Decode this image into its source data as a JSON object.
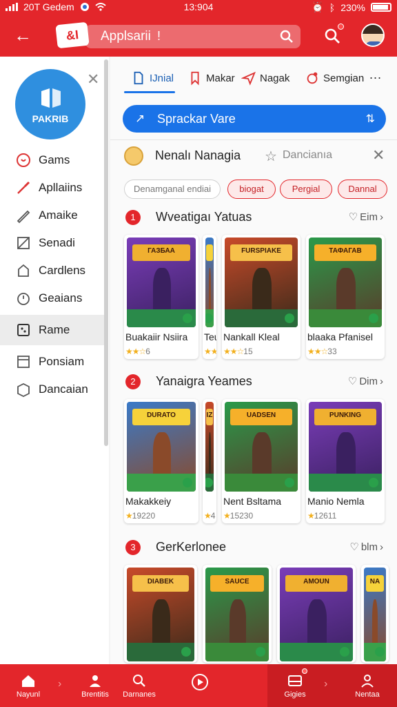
{
  "status": {
    "carrier": "20T Gedem",
    "time": "13:904",
    "battery": "230%"
  },
  "appbar": {
    "logo_text": "&I",
    "search_text": "Applsarii",
    "search_mark": "!"
  },
  "sidebar": {
    "brand_label": "PAKRIB",
    "items": [
      {
        "label": "Gams",
        "icon": "chat-icon"
      },
      {
        "label": "Apllaiins",
        "icon": "brush-icon"
      },
      {
        "label": "Amaike",
        "icon": "pencil-icon"
      },
      {
        "label": "Senadi",
        "icon": "slash-icon"
      },
      {
        "label": "Cardlens",
        "icon": "bag-icon"
      },
      {
        "label": "Geaians",
        "icon": "clock-icon"
      },
      {
        "label": "Rame",
        "icon": "dice-icon",
        "active": true
      },
      {
        "label": "Ponsiam",
        "icon": "window-icon"
      },
      {
        "label": "Dancaian",
        "icon": "box-icon"
      }
    ]
  },
  "tabs": [
    {
      "label": "IJnial",
      "icon": "doc-icon",
      "active": true
    },
    {
      "label": "Makar",
      "icon": "bookmark-icon"
    },
    {
      "label": "Nagak",
      "icon": "send-icon"
    },
    {
      "label": "Semgian",
      "icon": "alert-icon"
    }
  ],
  "tabs_more": "...",
  "promo": {
    "label": "Sprackar Vare"
  },
  "identity": {
    "name": "Nenalı Nanagia",
    "sub": "Dancianıa"
  },
  "chips": [
    "Denamganal endiai",
    "biogat",
    "Pergial",
    "Dannal"
  ],
  "sections": [
    {
      "num": "1",
      "title": "Wveatigaı Yatuas",
      "more": "Eim",
      "cards": [
        {
          "name": "Buakaiir Nsiira",
          "rating": "6",
          "stars": "★★☆",
          "art": "ГАЗБАА"
        },
        {
          "name": "Teu",
          "rating": "",
          "stars": "★★",
          "art": ""
        },
        {
          "name": "Nankall Kleal",
          "rating": "15",
          "stars": "★★☆",
          "art": "FURSPIAKE"
        },
        {
          "name": "blaaka Pfanisel",
          "rating": "33",
          "stars": "★★☆",
          "art": "ТАФАГАВ"
        }
      ]
    },
    {
      "num": "2",
      "title": "Yanaigra Yeames",
      "more": "Dim",
      "cards": [
        {
          "name": "Makakkeiy",
          "rating": "19220",
          "stars": "★",
          "art": "DURATO"
        },
        {
          "name": "",
          "rating": "4",
          "stars": "★",
          "art": "IZ"
        },
        {
          "name": "Nent Bsltama",
          "rating": "15230",
          "stars": "★",
          "art": "UADSEN"
        },
        {
          "name": "Manio Nemla",
          "rating": "12611",
          "stars": "★",
          "art": "PUNKING"
        }
      ]
    },
    {
      "num": "3",
      "title": "GerKerlonee",
      "more": "blm",
      "cards": [
        {
          "name": "",
          "rating": "",
          "stars": "",
          "art": "DIABEK"
        },
        {
          "name": "",
          "rating": "",
          "stars": "",
          "art": "SAUCE"
        },
        {
          "name": "",
          "rating": "",
          "stars": "",
          "art": "AMOUN"
        },
        {
          "name": "",
          "rating": "",
          "stars": "",
          "art": "NA"
        }
      ]
    }
  ],
  "bottom_nav": [
    {
      "label": "Nayunl",
      "icon": "home-icon"
    },
    {
      "label": "Brentitis",
      "icon": "person-icon"
    },
    {
      "label": "Darnanes",
      "icon": "search-icon"
    },
    {
      "label": "",
      "icon": "play-icon"
    },
    {
      "label": "Gigies",
      "icon": "tray-icon"
    },
    {
      "label": "Nentaa",
      "icon": "profile-icon"
    }
  ],
  "colors": {
    "brand_red": "#e3262b",
    "accent_blue": "#1a73e8",
    "sidebar_brand": "#2f8fdf"
  }
}
